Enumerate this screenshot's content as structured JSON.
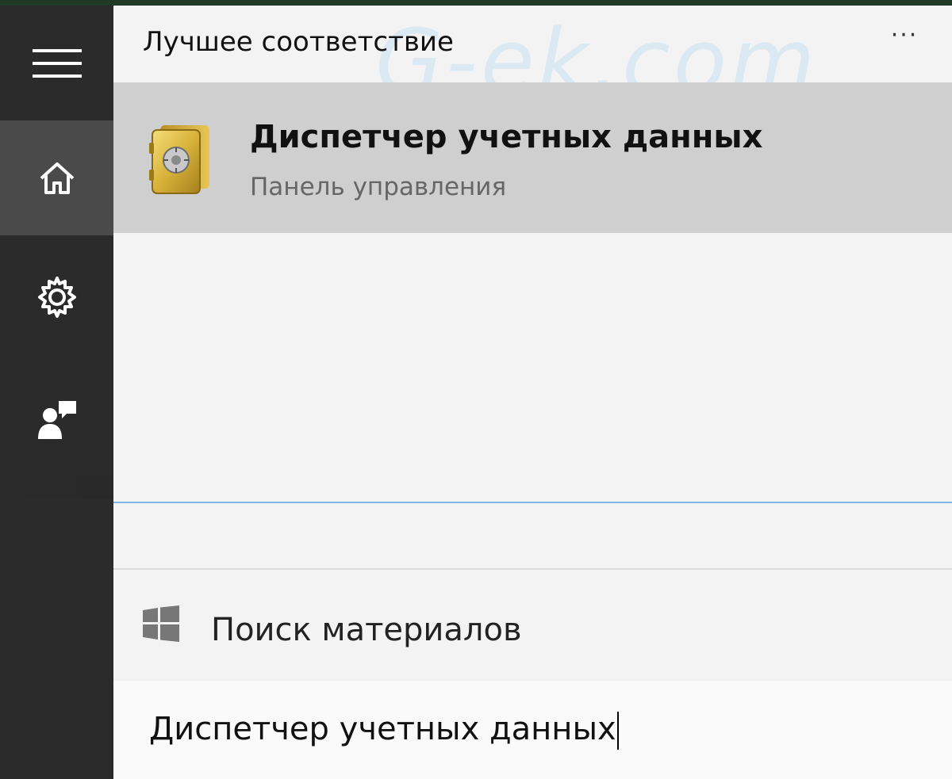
{
  "watermark": "G-ek.com",
  "rail": {
    "items": [
      {
        "name": "menu",
        "icon": "hamburger-icon"
      },
      {
        "name": "home",
        "icon": "home-icon"
      },
      {
        "name": "settings",
        "icon": "gear-icon"
      },
      {
        "name": "feedback",
        "icon": "feedback-icon"
      }
    ]
  },
  "panel": {
    "header": "Лучшее соответствие",
    "more_label": "···",
    "best_result": {
      "title": "Диспетчер учетных данных",
      "subtitle": "Панель управления",
      "icon": "safe-icon"
    },
    "search_web": {
      "label": "Поиск материалов",
      "icon": "windows-logo-icon"
    },
    "search": {
      "value": "Диспетчер учетных данных"
    }
  },
  "colors": {
    "rail_bg": "#2b2b2b",
    "rail_active": "#4a4a4a",
    "panel_bg": "#f3f3f3",
    "result_bg": "#cfcfcf",
    "accent": "#7fb6e6"
  }
}
